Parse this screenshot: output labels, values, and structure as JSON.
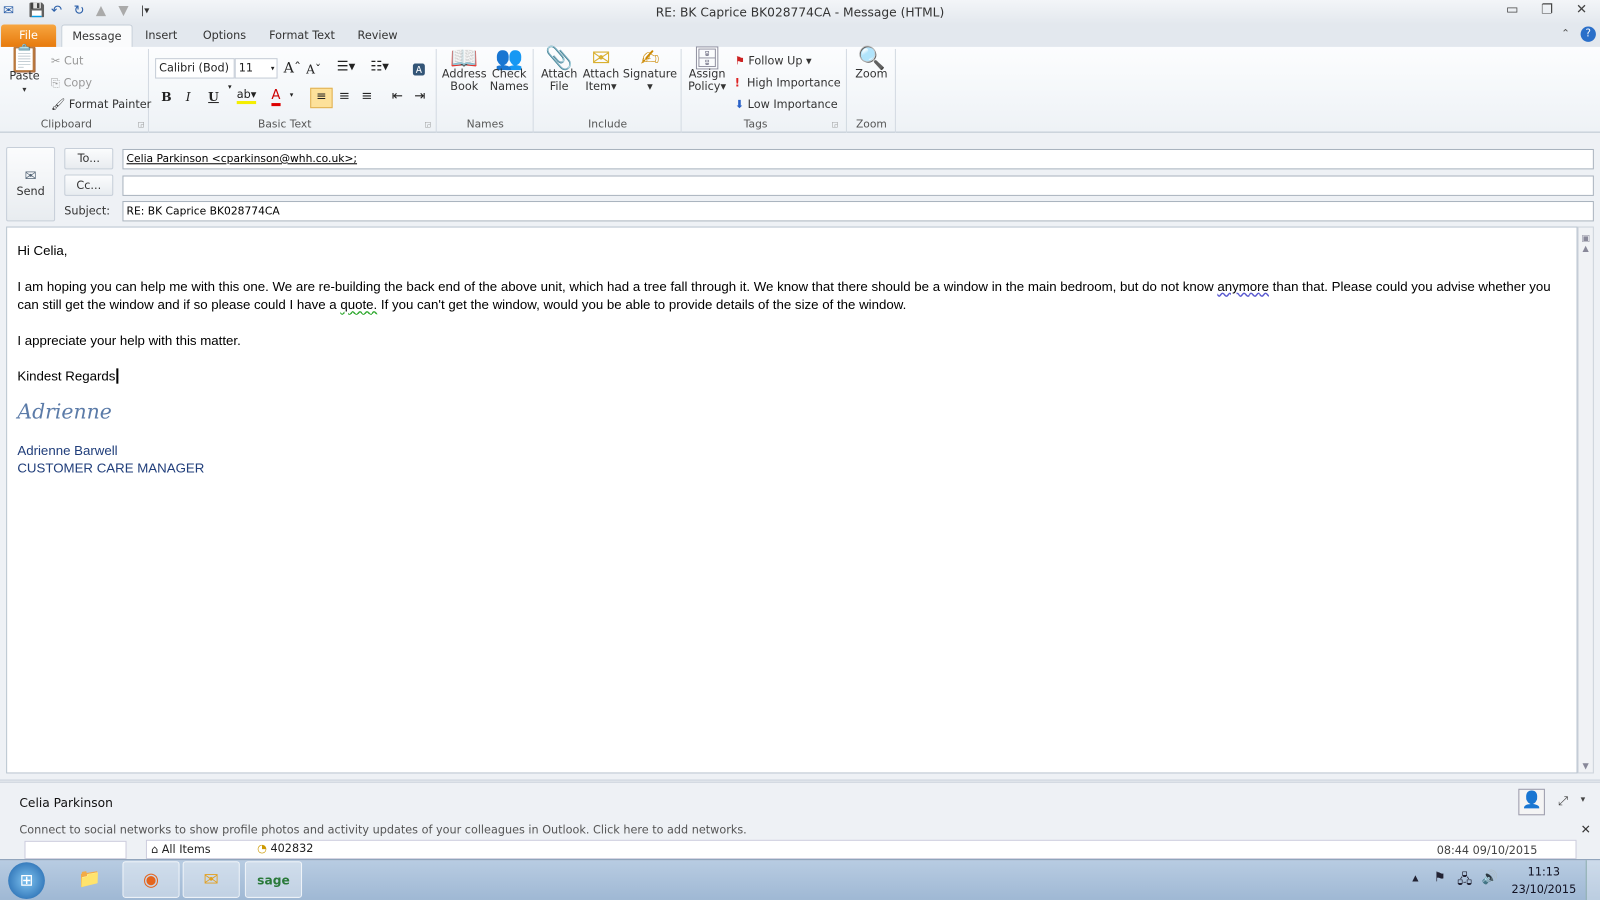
{
  "window": {
    "title": "RE: BK Caprice BK028774CA  -  Message (HTML)"
  },
  "quick_access": [
    "outlook-icon",
    "save-icon",
    "undo-icon",
    "redo-icon",
    "previous-item-icon",
    "next-item-icon",
    "customize-qat-icon"
  ],
  "tabs": [
    {
      "label": "File"
    },
    {
      "label": "Message"
    },
    {
      "label": "Insert"
    },
    {
      "label": "Options"
    },
    {
      "label": "Format Text"
    },
    {
      "label": "Review"
    }
  ],
  "ribbon": {
    "clipboard": {
      "label": "Clipboard",
      "paste": "Paste",
      "cut": "Cut",
      "copy": "Copy",
      "format_painter": "Format Painter"
    },
    "basic_text": {
      "label": "Basic Text",
      "font": "Calibri (Body)",
      "font_display": "Calibri (Bod)",
      "size": "11",
      "bold": "B",
      "italic": "I",
      "underline": "U",
      "font_color_glyph": "A"
    },
    "names": {
      "label": "Names",
      "address_book": [
        "Address",
        "Book"
      ],
      "check_names": [
        "Check",
        "Names"
      ]
    },
    "include": {
      "label": "Include",
      "attach_file": [
        "Attach",
        "File"
      ],
      "attach_item": [
        "Attach",
        "Item"
      ],
      "signature": "Signature"
    },
    "tags": {
      "label": "Tags",
      "assign_policy": [
        "Assign",
        "Policy"
      ],
      "follow_up": "Follow Up",
      "high": "High Importance",
      "low": "Low Importance"
    },
    "zoom": {
      "label": "Zoom",
      "zoom": "Zoom"
    }
  },
  "compose": {
    "send": "Send",
    "to_btn": "To...",
    "cc_btn": "Cc...",
    "subject_label": "Subject:",
    "to_value": "Celia Parkinson <cparkinson@whh.co.uk>;",
    "cc_value": "",
    "subject_value": "RE: BK Caprice BK028774CA"
  },
  "body": {
    "greeting": "Hi Celia,",
    "para1_a": "I am hoping you can help me with this one.  We are re-building the back end of the above unit, which had a tree fall through it.  We know that there should be a window in the main bedroom, but do not know ",
    "para1_sq1": "anymore",
    "para1_b": " than that.  Please could you advise whether you can still get the window and if so please could I have a ",
    "para1_sq2": "quote.",
    "para1_c": "  If you can't get the window, would you be able to provide details of the size of the window.",
    "para2": "I appreciate your help with this matter.",
    "closing": "Kindest Regards",
    "signature_script": "Adrienne",
    "sig_name": "Adrienne Barwell",
    "sig_title": "CUSTOMER CARE MANAGER"
  },
  "people_pane": {
    "name": "Celia Parkinson",
    "notice": "Connect to social networks to show profile photos and activity updates of your colleagues in Outlook. Click here to add networks.",
    "tab_all": "All Items",
    "item_subject": "402832",
    "item_date": "08:44 09/10/2015"
  },
  "taskbar": {
    "time": "11:13",
    "date": "23/10/2015"
  }
}
